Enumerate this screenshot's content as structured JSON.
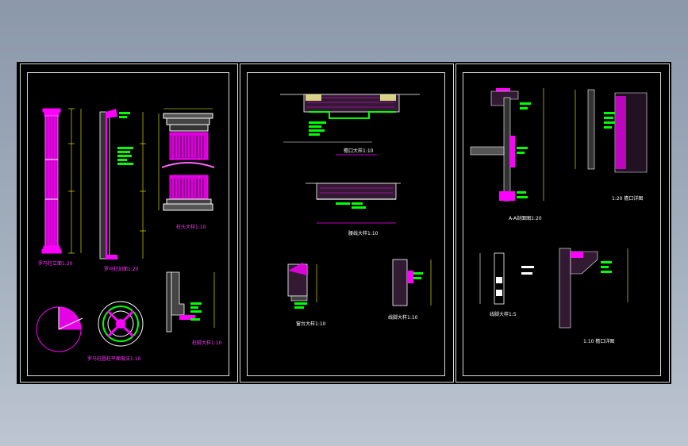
{
  "drawing": {
    "background": "#000000",
    "colors": {
      "magenta": "#ff00ff",
      "green": "#00ff00",
      "cyan": "#00ffff",
      "yellow": "#ffff00",
      "white": "#ffffff",
      "red": "#ff3333"
    }
  },
  "sheet1": {
    "col_elev": "罗马柱立面1:20",
    "col_section": "罗马柱剖面1:20",
    "cap_detail": "柱头大样1:10",
    "plan_detail": "罗马柱圆柱平面做法1:10",
    "base_detail": "柱脚大样1:10"
  },
  "sheet2": {
    "title1": "檐口大样1:10",
    "title2": "腰线大样1:10",
    "title3": "窗台大样1:10",
    "title4": "线脚大样1:10"
  },
  "sheet3": {
    "title_a": "A-A剖面图1:20",
    "title_b": "1:20 檐口详图",
    "title_c": "线脚大样1:5",
    "title_d": "1:10 檐口详图"
  }
}
